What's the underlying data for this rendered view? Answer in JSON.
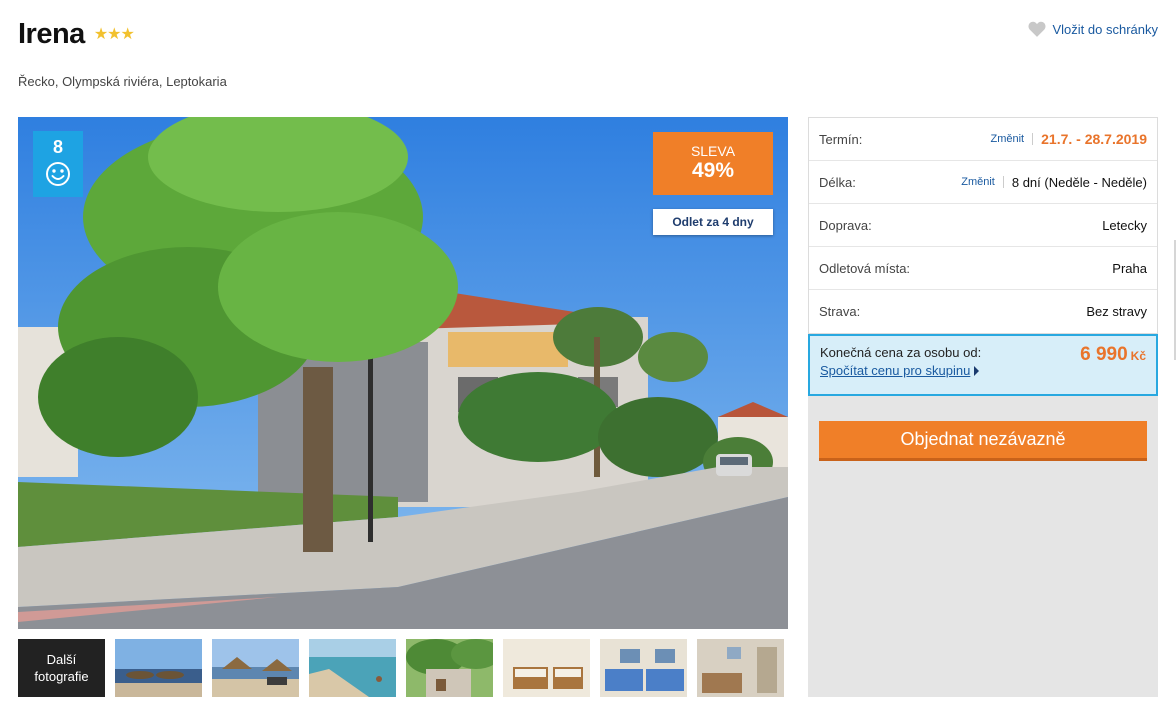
{
  "hotel": {
    "name": "Irena",
    "stars": "★★★",
    "location": "Řecko, Olympská riviéra, Leptokaria"
  },
  "wishlist": {
    "label": "Vložit do schránky"
  },
  "photo": {
    "rating": "8",
    "sale_label": "SLEVA",
    "sale_value": "49%",
    "departure_badge": "Odlet za 4 dny"
  },
  "thumbnails": {
    "more_label_line1": "Další",
    "more_label_line2": "fotografie"
  },
  "details": {
    "term_label": "Termín:",
    "term_change": "Změnit",
    "term_value": "21.7. - 28.7.2019",
    "length_label": "Délka:",
    "length_change": "Změnit",
    "length_value": "8 dní (Neděle - Neděle)",
    "transport_label": "Doprava:",
    "transport_value": "Letecky",
    "departure_label": "Odletová místa:",
    "departure_value": "Praha",
    "board_label": "Strava:",
    "board_value": "Bez stravy"
  },
  "price": {
    "label": "Konečná cena za osobu od:",
    "value": "6 990",
    "currency": "Kč",
    "group_link": "Spočítat cenu pro skupinu"
  },
  "order_button": "Objednat nezávazně",
  "colors": {
    "accent_orange": "#f07f28",
    "badge_blue": "#1ea3e3",
    "link_blue": "#1a5aa0",
    "star_yellow": "#f2c12e"
  }
}
